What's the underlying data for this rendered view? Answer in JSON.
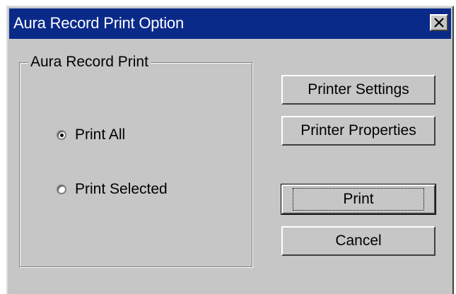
{
  "window": {
    "title": "Aura Record Print Option"
  },
  "group": {
    "legend": "Aura Record Print",
    "options": [
      {
        "label": "Print All",
        "checked": true
      },
      {
        "label": "Print Selected",
        "checked": false
      }
    ]
  },
  "buttons": {
    "printer_settings": "Printer Settings",
    "printer_properties": "Printer Properties",
    "print": "Print",
    "cancel": "Cancel"
  },
  "colors": {
    "titlebar": "#0a2a8a",
    "face": "#c6c6c6"
  }
}
